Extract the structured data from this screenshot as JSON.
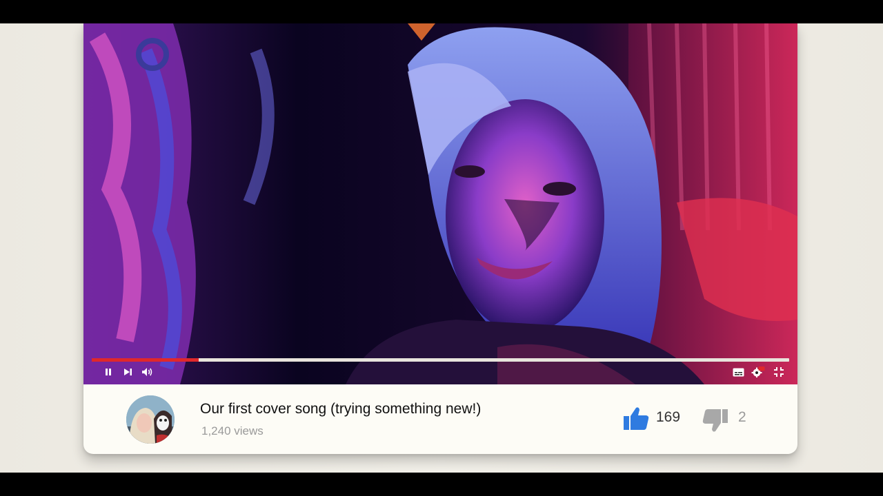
{
  "player": {
    "progress_fraction": 0.153,
    "controls": [
      "pause-icon",
      "next-icon",
      "volume-icon",
      "subtitles-icon",
      "settings-hd-icon",
      "exit-fullscreen-icon"
    ],
    "colors": {
      "progress": "#e0282b",
      "track": "#e8e4dc"
    }
  },
  "video_info": {
    "title": "Our first cover song (trying something new!)",
    "views": "1,240 views",
    "likes": "169",
    "dislikes": "2",
    "colors": {
      "like": "#2f7be0",
      "dislike": "#a8a8a8"
    }
  }
}
